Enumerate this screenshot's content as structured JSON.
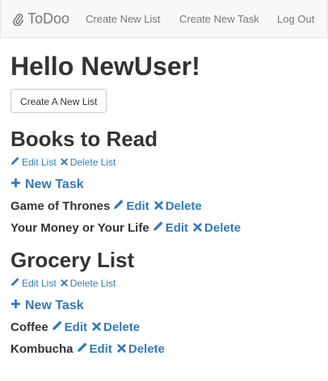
{
  "navbar": {
    "brand": "ToDoo",
    "links": [
      "Create New List",
      "Create New Task",
      "Log Out"
    ]
  },
  "main": {
    "greeting": "Hello NewUser!",
    "create_list_button": "Create A New List",
    "lists": [
      {
        "title": "Books to Read",
        "edit_label": "Edit List",
        "delete_label": "Delete List",
        "new_task_label": "New Task",
        "tasks": [
          {
            "name": "Game of Thrones",
            "edit": "Edit",
            "delete": "Delete"
          },
          {
            "name": "Your Money or Your Life",
            "edit": "Edit",
            "delete": "Delete"
          }
        ]
      },
      {
        "title": "Grocery List",
        "edit_label": "Edit List",
        "delete_label": "Delete List",
        "new_task_label": "New Task",
        "tasks": [
          {
            "name": "Coffee",
            "edit": "Edit",
            "delete": "Delete"
          },
          {
            "name": "Kombucha",
            "edit": "Edit",
            "delete": "Delete"
          }
        ]
      }
    ]
  },
  "colors": {
    "link": "#337ab7",
    "text": "#333333",
    "navbar_bg": "#f8f8f8",
    "navbar_text": "#777777"
  },
  "icons": {
    "brand": "paperclip-icon",
    "edit": "pencil-icon",
    "delete": "remove-icon",
    "add": "plus-icon"
  }
}
